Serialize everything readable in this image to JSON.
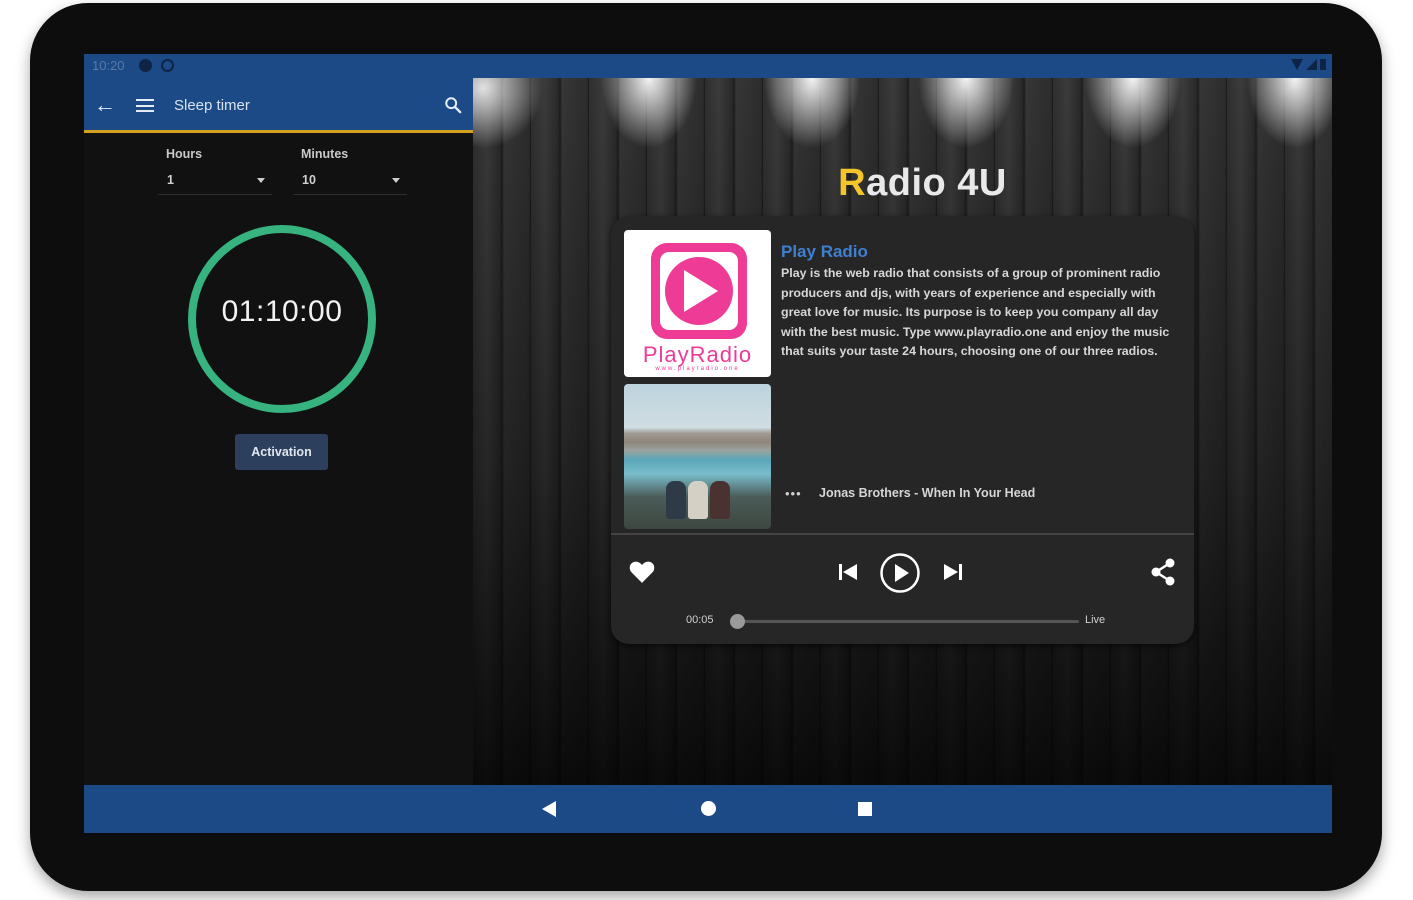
{
  "status_bar": {
    "time": "10:20"
  },
  "sleep_timer": {
    "title": "Sleep timer",
    "hours_label": "Hours",
    "hours_value": "1",
    "minutes_label": "Minutes",
    "minutes_value": "10",
    "countdown": "01:10:00",
    "activation_label": "Activation"
  },
  "player": {
    "brand_first": "R",
    "brand_rest": "adio 4U",
    "station_name": "Play Radio",
    "station_description": "Play is the web radio that consists of a group of prominent radio producers and djs, with years of experience and especially with great love for music. Its purpose is to keep you company all day with the best music. Type www.playradio.one and enjoy the music that suits your taste 24 hours, choosing one of our three radios.",
    "logo_text": "PlayRadio",
    "logo_url": "www.playradio.one",
    "more_label": "•••",
    "now_playing": "Jonas Brothers - When In Your Head",
    "elapsed": "00:05",
    "live_label": "Live",
    "progress_fraction": 0.0
  },
  "icons": [
    "back-arrow-icon",
    "menu-icon",
    "search-icon",
    "heart-icon",
    "skip-previous-icon",
    "play-icon",
    "skip-next-icon",
    "share-icon"
  ],
  "colors": {
    "bar_blue": "#1b4a87",
    "accent_yellow": "#f3c52a",
    "timer_green": "#36b37e",
    "station_blue": "#3f7fd0",
    "brand_pink": "#ee3b96"
  }
}
